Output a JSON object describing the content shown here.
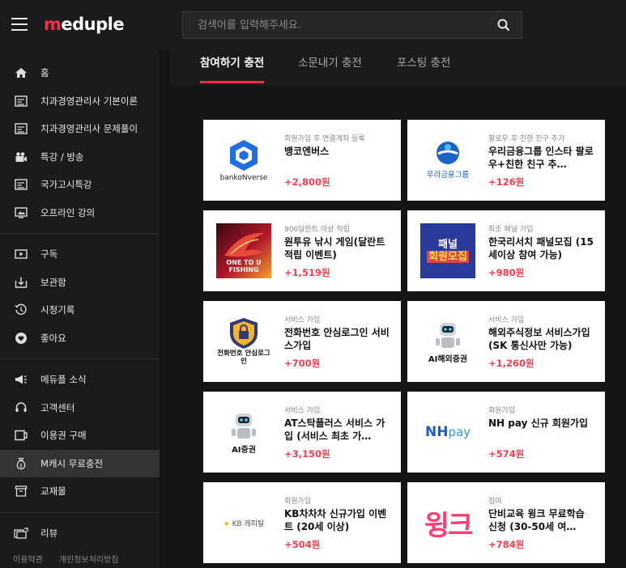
{
  "header": {
    "logo_m": "m",
    "logo_rest": "eduple",
    "search_placeholder": "검색어를 입력해주세요."
  },
  "sidebar": {
    "groups": [
      [
        {
          "label": "홈",
          "icon": "home-icon"
        },
        {
          "label": "치과경영관리사 기본이론",
          "icon": "book-icon"
        },
        {
          "label": "치과경영관리사 문제풀이",
          "icon": "book-icon"
        },
        {
          "label": "특강 / 방송",
          "icon": "camera-icon"
        },
        {
          "label": "국가고시특강",
          "icon": "book-icon"
        },
        {
          "label": "오프라인 강의",
          "icon": "monitor-icon"
        }
      ],
      [
        {
          "label": "구독",
          "icon": "subscribe-icon"
        },
        {
          "label": "보관함",
          "icon": "download-icon"
        },
        {
          "label": "시청기록",
          "icon": "history-icon"
        },
        {
          "label": "좋아요",
          "icon": "heart-icon"
        }
      ],
      [
        {
          "label": "메듀플 소식",
          "icon": "megaphone-icon"
        },
        {
          "label": "고객센터",
          "icon": "headset-icon"
        },
        {
          "label": "이용권 구매",
          "icon": "ticket-icon"
        },
        {
          "label": "M캐시 무료충전",
          "icon": "moneybag-icon",
          "active": true
        },
        {
          "label": "교재몰",
          "icon": "store-icon"
        }
      ],
      [
        {
          "label": "리뷰",
          "icon": "review-icon"
        }
      ]
    ],
    "footer": {
      "terms": "이용약관",
      "privacy": "개인정보처리방침"
    }
  },
  "tabs": [
    {
      "label": "참여하기 충전",
      "active": true
    },
    {
      "label": "소문내기 충전",
      "active": false
    },
    {
      "label": "포스팅 충전",
      "active": false
    }
  ],
  "offers": [
    {
      "category": "회원가입 후 연결계좌 등록",
      "title": "뱅코엔버스",
      "reward": "+2,800원",
      "thumb": "banko-logo",
      "thumb_text": "bankoNverse"
    },
    {
      "category": "팔로우 후 친한 친구 추가",
      "title": "우리금융그룹 인스타 팔로우+친한 친구 추…",
      "reward": "+126원",
      "thumb": "woori-logo",
      "thumb_text": "우리금융그룹"
    },
    {
      "category": "900달란트 이상 적립",
      "title": "원투유 낚시 게임(달란트 적립 이벤트)",
      "reward": "+1,519원",
      "thumb": "fishing-game-art",
      "thumb_text": "ONE TO U FISHING"
    },
    {
      "category": "최초 패널 가입",
      "title": "한국리서치 패널모집 (15세이상 참여 가능)",
      "reward": "+980원",
      "thumb": "panel-poster",
      "thumb_text": "패널 회원모집"
    },
    {
      "category": "서비스 가입",
      "title": "전화번호 안심로그인 서비스가입",
      "reward": "+700원",
      "thumb": "shield-lock-logo",
      "thumb_text": "전화번호 안심로그인"
    },
    {
      "category": "서비스 가입",
      "title": "해외주식정보 서비스가입 (SK 통신사만 가능)",
      "reward": "+1,260원",
      "thumb": "robot-logo",
      "thumb_text": "AI해외증권"
    },
    {
      "category": "서비스 가입",
      "title": "AT스탁플러스 서비스 가입 (서비스 최초 가…",
      "reward": "+3,150원",
      "thumb": "robot-logo",
      "thumb_text": "AI증권"
    },
    {
      "category": "회원가입",
      "title": "NH pay 신규 회원가입",
      "reward": "+574원",
      "thumb": "nhpay-logo",
      "thumb_text": "NHpay"
    },
    {
      "category": "회원가입",
      "title": "KB차차차 신규가입 이벤트 (20세 이상)",
      "reward": "+504원",
      "thumb": "kb-logo",
      "thumb_text": "KB 캐피탈"
    },
    {
      "category": "참여",
      "title": "단비교육 윙크 무료학습 신청 (30-50세 여…",
      "reward": "+784원",
      "thumb": "wink-logo",
      "thumb_text": "윙크"
    }
  ],
  "colors": {
    "accent": "#ff2a4a",
    "reward": "#ff3b4e",
    "bg": "#141414",
    "panel": "#1b1b1b"
  }
}
